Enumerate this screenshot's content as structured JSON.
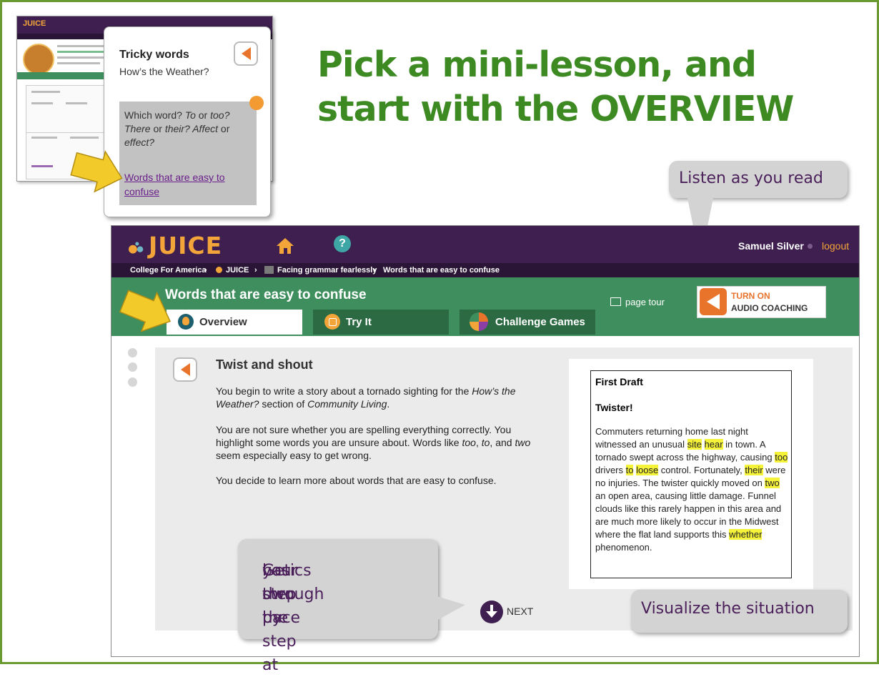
{
  "slide": {
    "headline_line1": "Pick a mini-lesson, and",
    "headline_line2": "start with the OVERVIEW"
  },
  "callouts": {
    "listen": "Listen as you read",
    "basics_line1": "Get through the",
    "basics_line2": "basics step by step at",
    "basics_line3": "your own pace",
    "visualize": "Visualize the situation"
  },
  "popup": {
    "title": "Tricky words",
    "subtitle": "How’s the Weather?",
    "desc_1": "Which word? ",
    "desc_2": "To",
    "desc_3": " or ",
    "desc_4": "too?",
    "desc_5": "There",
    "desc_6": " or ",
    "desc_7": "their?",
    "desc_8": " Affect",
    "desc_9": " or",
    "desc_10": "effect?",
    "link": "Words that are easy to confuse"
  },
  "app": {
    "logo": "JUICE",
    "help": "?",
    "user": "Samuel Silver",
    "logout": "logout",
    "breadcrumb": {
      "c1": "College For America",
      "c2": "JUICE",
      "c3": "Facing grammar fearlessly",
      "c4": "Words that are easy to confuse"
    },
    "page_title": "Words that are easy to confuse",
    "tabs": {
      "overview": "Overview",
      "try_it": "Try It",
      "challenge": "Challenge Games"
    },
    "page_tour": "page tour",
    "audio_1": "TURN ON",
    "audio_2": "AUDIO COACHING",
    "lesson": {
      "title": "Twist and shout",
      "p1a": "You begin to write a story about a tornado sighting for the ",
      "p1b": "How’s the Weather?",
      "p1c": " section of ",
      "p1d": "Community Living",
      "p1e": ".",
      "p2a": "You are not sure whether you are spelling everything correctly. You highlight some words you are unsure about.  Words like ",
      "p2b": "too",
      "p2c": ", ",
      "p2d": "to",
      "p2e": ", and ",
      "p2f": "two",
      "p2g": " seem especially easy to get wrong.",
      "p3": "You decide to learn more about words that are easy to confuse.",
      "next": "NEXT"
    },
    "draft": {
      "heading": "First Draft",
      "title": "Twister!",
      "s1": "Commuters returning home last night witnessed an unusual ",
      "h1": "site",
      "s2": " ",
      "h2": "hear",
      "s3": " in town. A tornado swept across the highway, causing ",
      "h3": "too",
      "s4": " drivers ",
      "h4": "to",
      "s5": " ",
      "h5": "loose",
      "s6": " control. Fortunately, ",
      "h6": "their",
      "s7": " were no injuries. The twister quickly moved on ",
      "h7": "two",
      "s8": " an open area, causing little damage. Funnel clouds like this rarely happen in this area and are much more likely to occur in the Midwest where the flat land supports this ",
      "h8": "whether",
      "s9": " phenomenon."
    }
  },
  "colors": {
    "headline": "#3d8a23",
    "purple": "#3e1f4f",
    "green": "#3f8f5e",
    "orange": "#f3a53a",
    "highlight": "#f5f23a",
    "arrow": "#f2cb2b"
  }
}
